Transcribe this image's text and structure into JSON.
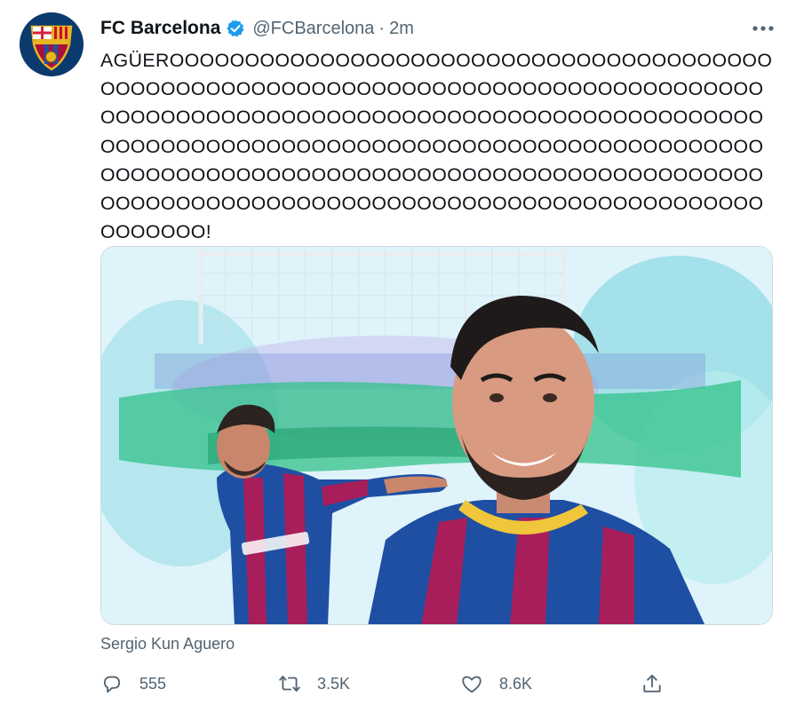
{
  "tweet": {
    "author_name": "FC Barcelona",
    "handle": "@FCBarcelona",
    "separator": "·",
    "time": "2m",
    "verified": true,
    "text": "AGÜEROOOOOOOOOOOOOOOOOOOOOOOOOOOOOOOOOOOOOOOOOOOOOOOOOOOOOOOOOOOOOOOOOOOOOOOOOOOOOOOOOOOOOOOOOOOOOOOOOOOOOOOOOOOOOOOOOOOOOOOOOOOOOOOOOOOOOOOOOOOOOOOOOOOOOOOOOOOOOOOOOOOOOOOOOOOOOOOOOOOOOOOOOOOOOOOOOOOOOOOOOOOOOOOOOOOOOOOOOOOOOOOOOOOOOOOOOOOOOOOOOOOOOOOOOOOOOOOOOOOOOOOOOOO!",
    "media_caption": "Sergio Kun Aguero",
    "icons": {
      "avatar": "fc-barcelona-crest",
      "verified": "verified-badge-icon",
      "more": "more-options-icon",
      "reply": "reply-icon",
      "retweet": "retweet-icon",
      "like": "like-icon",
      "share": "share-icon"
    },
    "colors": {
      "verified": "#1d9bf0",
      "muted": "#536471",
      "text": "#0f1419",
      "blaugrana_blue": "#1f4fa3",
      "blaugrana_red": "#a81e5a"
    }
  },
  "actions": {
    "reply_count": "555",
    "retweet_count": "3.5K",
    "like_count": "8.6K"
  }
}
